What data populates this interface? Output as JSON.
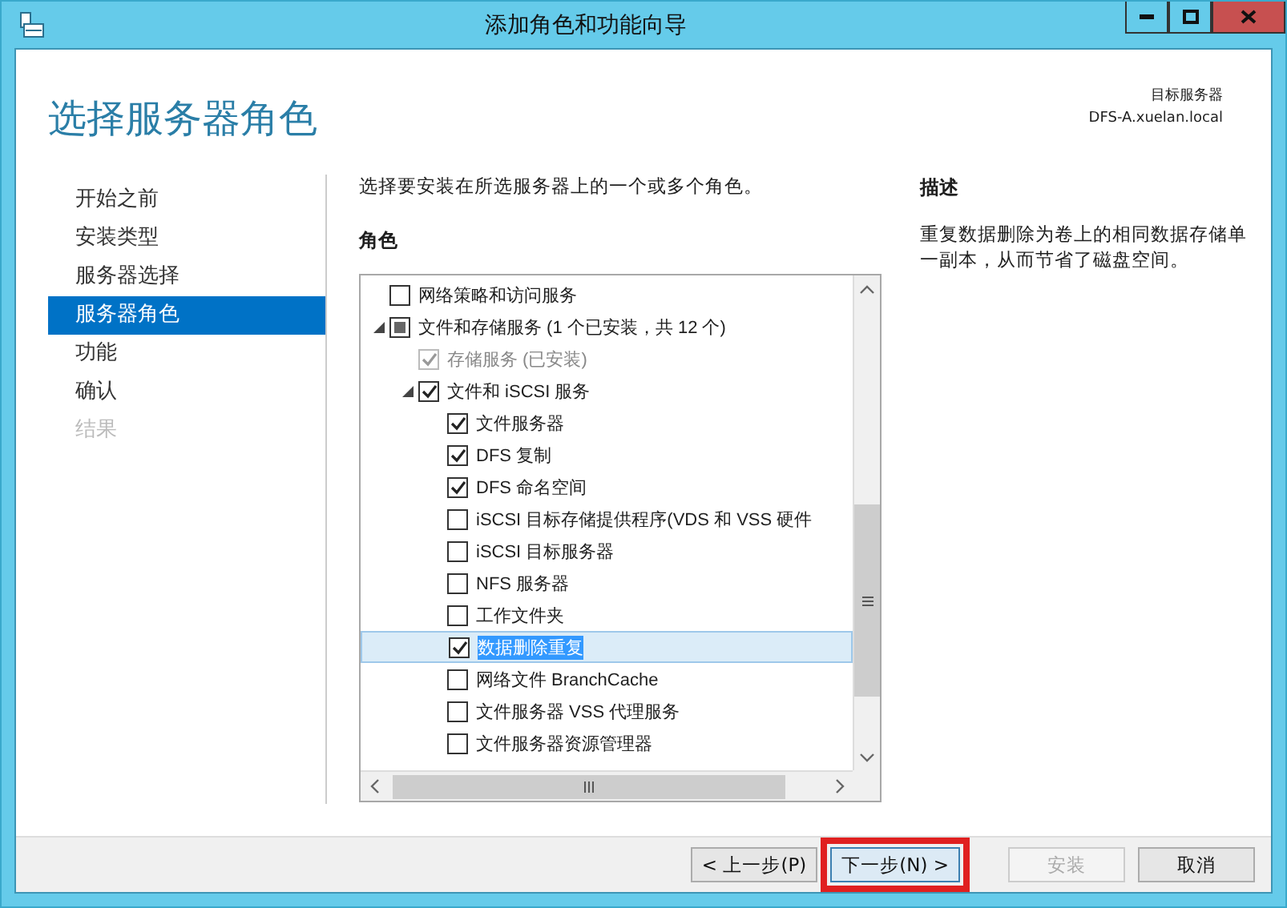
{
  "window": {
    "title": "添加角色和功能向导"
  },
  "header": {
    "title": "选择服务器角色",
    "target_label": "目标服务器",
    "target_server": "DFS-A.xuelan.local"
  },
  "steps": [
    {
      "label": "开始之前",
      "selected": false,
      "disabled": false
    },
    {
      "label": "安装类型",
      "selected": false,
      "disabled": false
    },
    {
      "label": "服务器选择",
      "selected": false,
      "disabled": false
    },
    {
      "label": "服务器角色",
      "selected": true,
      "disabled": false
    },
    {
      "label": "功能",
      "selected": false,
      "disabled": false
    },
    {
      "label": "确认",
      "selected": false,
      "disabled": false
    },
    {
      "label": "结果",
      "selected": false,
      "disabled": true
    }
  ],
  "instruction": "选择要安装在所选服务器上的一个或多个角色。",
  "roles": {
    "heading": "角色",
    "items": [
      {
        "label": "网络策略和访问服务",
        "checked": false,
        "disabled": false,
        "selected": false
      },
      {
        "label": "文件和存储服务 (1 个已安装，共 12 个)",
        "checked": false,
        "partial": true,
        "disabled": false,
        "selected": false,
        "expanded": true,
        "children": [
          {
            "label": "存储服务 (已安装)",
            "checked": true,
            "disabled": true,
            "selected": false
          },
          {
            "label": "文件和 iSCSI 服务",
            "checked": true,
            "disabled": false,
            "selected": false,
            "expanded": true,
            "children": [
              {
                "label": "文件服务器",
                "checked": true,
                "disabled": false,
                "selected": false
              },
              {
                "label": "DFS 复制",
                "checked": true,
                "disabled": false,
                "selected": false
              },
              {
                "label": "DFS 命名空间",
                "checked": true,
                "disabled": false,
                "selected": false
              },
              {
                "label": "iSCSI 目标存储提供程序(VDS 和 VSS 硬件",
                "checked": false,
                "disabled": false,
                "selected": false
              },
              {
                "label": "iSCSI 目标服务器",
                "checked": false,
                "disabled": false,
                "selected": false
              },
              {
                "label": "NFS 服务器",
                "checked": false,
                "disabled": false,
                "selected": false
              },
              {
                "label": "工作文件夹",
                "checked": false,
                "disabled": false,
                "selected": false
              },
              {
                "label": "数据删除重复",
                "checked": true,
                "disabled": false,
                "selected": true
              },
              {
                "label": "网络文件 BranchCache",
                "checked": false,
                "disabled": false,
                "selected": false
              },
              {
                "label": "文件服务器 VSS 代理服务",
                "checked": false,
                "disabled": false,
                "selected": false
              },
              {
                "label": "文件服务器资源管理器",
                "checked": false,
                "disabled": false,
                "selected": false
              }
            ]
          }
        ]
      }
    ]
  },
  "description": {
    "heading": "描述",
    "text": "重复数据删除为卷上的相同数据存储单一副本，从而节省了磁盘空间。"
  },
  "buttons": [
    {
      "label": "< 上一步(P)",
      "disabled": false,
      "highlighted": false
    },
    {
      "label": "下一步(N) >",
      "disabled": false,
      "highlighted": true
    },
    {
      "label": "安装",
      "disabled": true,
      "highlighted": false
    },
    {
      "label": "取消",
      "disabled": false,
      "highlighted": false
    }
  ]
}
